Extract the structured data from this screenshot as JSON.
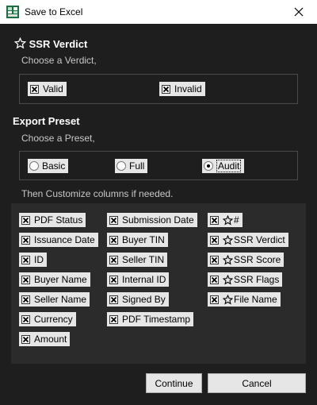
{
  "window": {
    "title": "Save to Excel"
  },
  "verdict": {
    "title": "SSR Verdict",
    "hint": "Choose a Verdict,",
    "options": [
      {
        "label": "Valid",
        "checked": true
      },
      {
        "label": "Invalid",
        "checked": true
      }
    ]
  },
  "preset": {
    "title": "Export Preset",
    "hint": "Choose a Preset,",
    "options": [
      {
        "label": "Basic",
        "selected": false
      },
      {
        "label": "Full",
        "selected": false
      },
      {
        "label": "Audit",
        "selected": true
      }
    ]
  },
  "columns": {
    "hint": "Then Customize columns if needed.",
    "col1": [
      "PDF Status",
      "Issuance Date",
      "ID",
      "Buyer Name",
      "Seller Name",
      "Currency",
      "Amount"
    ],
    "col2": [
      "Submission Date",
      "Buyer TIN",
      "Seller TIN",
      "Internal ID",
      "Signed By",
      "PDF Timestamp"
    ],
    "col3": [
      "#",
      "SSR Verdict",
      "SSR Score",
      "SSR Flags",
      "File Name"
    ]
  },
  "buttons": {
    "continue": "Continue",
    "cancel": "Cancel"
  },
  "icons": {
    "app": "excel-app-icon",
    "close": "close-icon",
    "star": "star-icon",
    "check": "check-x-icon"
  },
  "colors": {
    "background": "#1e1e1e",
    "panel": "#2b2b2b",
    "control": "#e6e6e6",
    "titlebar": "#ffffff"
  }
}
